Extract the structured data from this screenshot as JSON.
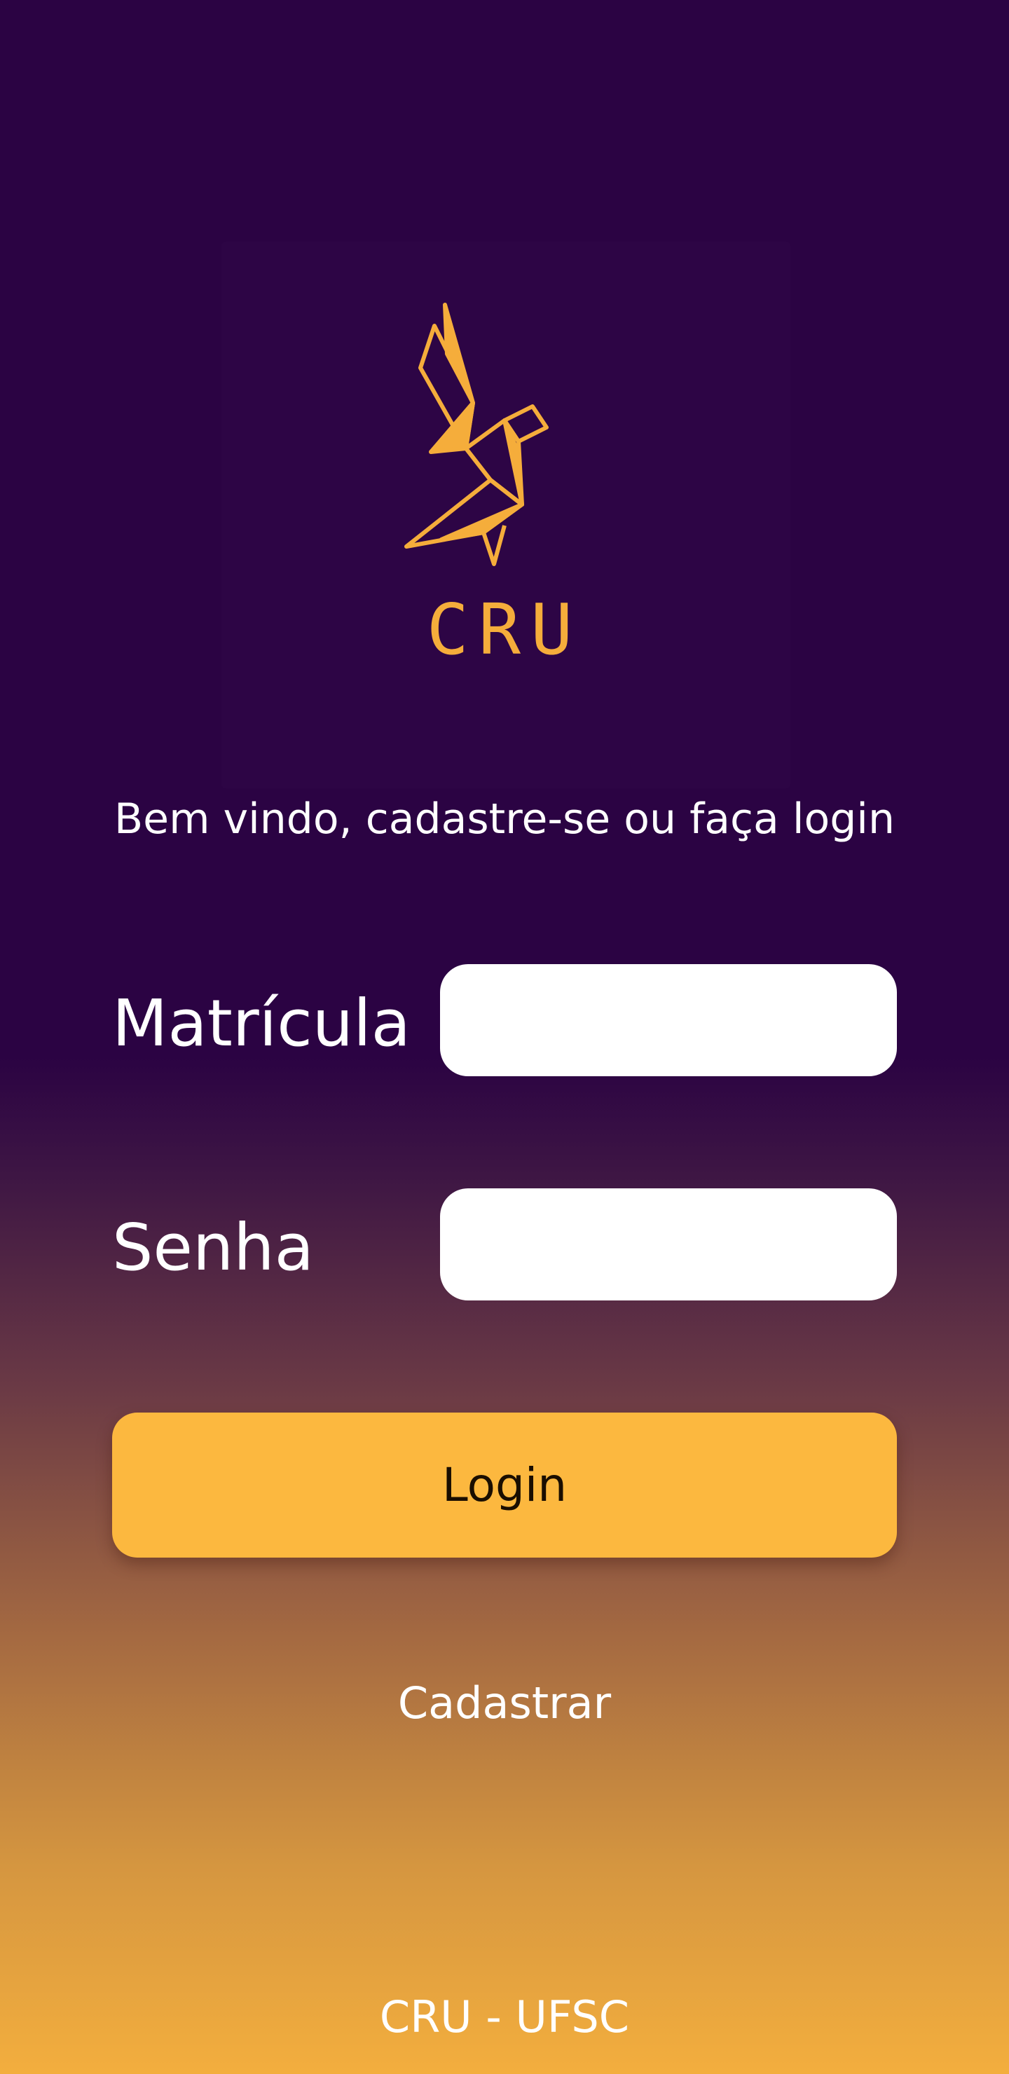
{
  "logo": {
    "text": "CRU",
    "icon": "origami-bird-icon",
    "color": "#f5ad3b"
  },
  "welcome_text": "Bem vindo, cadastre-se ou faça login",
  "form": {
    "matricula_label": "Matrícula",
    "matricula_value": "",
    "senha_label": "Senha",
    "senha_value": ""
  },
  "login_button_label": "Login",
  "signup_link_label": "Cadastrar",
  "footer_text": "CRU - UFSC",
  "colors": {
    "background_top": "#2b0343",
    "background_bottom": "#f3ae3e",
    "accent": "#fcb83f"
  }
}
